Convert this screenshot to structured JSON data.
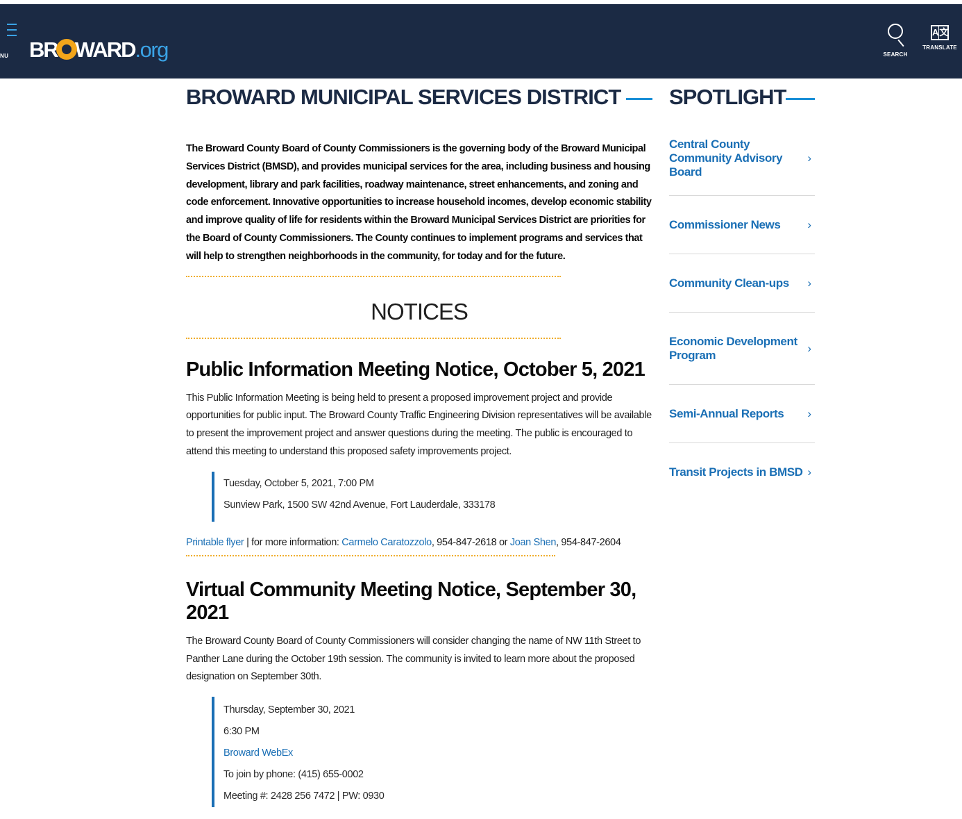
{
  "header": {
    "menu_label": "NU",
    "logo_part1": "BR",
    "logo_part2": "WARD",
    "logo_part3": ".org",
    "search_label": "SEARCH",
    "translate_label": "TRANSLATE",
    "translate_glyph_left": "A",
    "translate_glyph_right": "文"
  },
  "main": {
    "title": "BROWARD MUNICIPAL SERVICES DISTRICT",
    "intro": "The Broward County Board of County Commissioners is the governing body of the Broward Municipal Services District (BMSD), and provides municipal services for the area, including business and housing development, library and park facilities, roadway maintenance, street enhancements, and zoning and code enforcement. Innovative opportunities to increase household incomes, develop economic stability and improve quality of life for residents within the Broward Municipal Services District are priorities for the Board of County Commissioners. The County continues to implement programs and services that will help to strengthen neighborhoods in the community, for today and for the future.",
    "notices_heading": "NOTICES",
    "notice1": {
      "title": "Public Information Meeting Notice, October 5, 2021",
      "body": "This Public Information Meeting is being held to present a proposed improvement project and provide opportunities for public input. The Broward County Traffic Engineering Division representatives will be available to present the improvement project and answer questions during the meeting. The public is encouraged to attend this meeting to understand this proposed safety improvements project.",
      "when": "Tuesday, October 5, 2021, 7:00 PM",
      "where": "Sunview Park, 1500 SW 42nd Avenue, Fort Lauderdale, 333178",
      "flyer_link": "Printable flyer",
      "more_info": " | for more information: ",
      "contact1_link": "Carmelo Caratozzolo",
      "contact1_phone": ", 954-847-2618 or ",
      "contact2_link": "Joan Shen",
      "contact2_phone": ", 954-847-2604"
    },
    "notice2": {
      "title": "Virtual Community Meeting Notice, September 30, 2021",
      "body": "The Broward County Board of County Commissioners will consider changing the name of NW 11th Street to Panther Lane during the October 19th session.  The community is invited to learn more about the proposed designation on September 30th.",
      "date": "Thursday, September 30, 2021",
      "time": "6:30 PM",
      "webex_link": "Broward WebEx",
      "phone": "To join by phone: (415) 655-0002",
      "meeting": "Meeting #: 2428 256 7472 | PW: 0930"
    }
  },
  "spotlight": {
    "title": "SPOTLIGHT",
    "items": [
      {
        "label": "Central County Community Advisory Board",
        "chevron": "›"
      },
      {
        "label": "Commissioner News",
        "chevron": "›"
      },
      {
        "label": "Community Clean-ups",
        "chevron": "›"
      },
      {
        "label": "Economic Development Program",
        "chevron": "›"
      },
      {
        "label": "Semi-Annual Reports",
        "chevron": "›"
      },
      {
        "label": "Transit Projects in BMSD",
        "chevron": "›"
      }
    ]
  },
  "colors": {
    "header_bg": "#1b2a44",
    "accent_blue": "#1a8fd7",
    "link_blue": "#1a6fb5",
    "dotted_rule": "#f0ae2d"
  }
}
